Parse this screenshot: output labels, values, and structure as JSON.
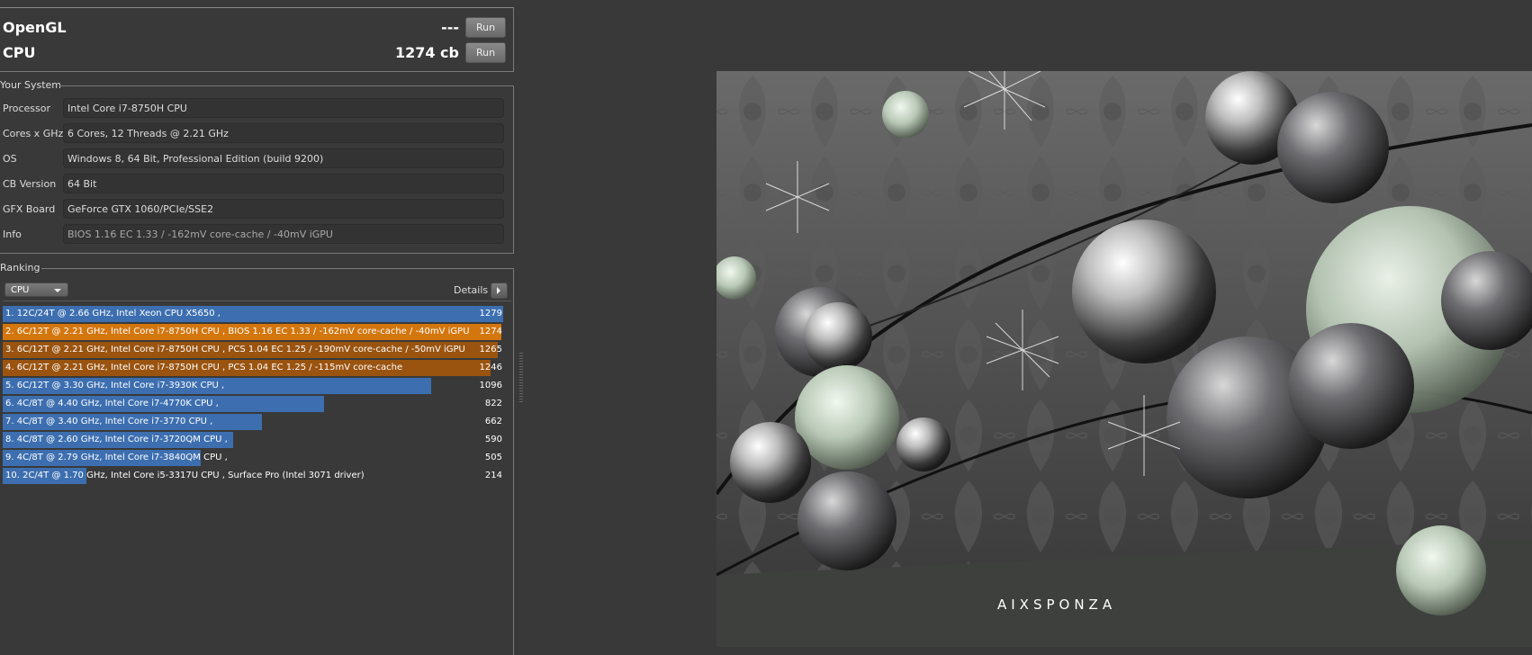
{
  "benchmarks": [
    {
      "label": "OpenGL",
      "score": "---",
      "button": "Run"
    },
    {
      "label": "CPU",
      "score": "1274 cb",
      "button": "Run"
    }
  ],
  "your_system": {
    "title": "Your System",
    "rows": [
      {
        "key": "Processor",
        "value": "Intel Core i7-8750H CPU"
      },
      {
        "key": "Cores x GHz",
        "value": "6 Cores, 12 Threads @ 2.21 GHz"
      },
      {
        "key": "OS",
        "value": "Windows 8, 64 Bit, Professional Edition (build 9200)"
      },
      {
        "key": "CB Version",
        "value": "64 Bit"
      },
      {
        "key": "GFX Board",
        "value": "GeForce GTX 1060/PCIe/SSE2"
      },
      {
        "key": "Info",
        "value": "BIOS 1.16 EC 1.33 / -162mV core-cache / -40mV iGPU"
      }
    ]
  },
  "ranking": {
    "title": "Ranking",
    "selected": "CPU",
    "details_label": "Details",
    "max_score": 1279,
    "rows": [
      {
        "text": "1. 12C/24T @ 2.66 GHz, Intel Xeon CPU X5650 ,",
        "score": "1279",
        "value": 1279,
        "color": "#3d6fb0"
      },
      {
        "text": "2. 6C/12T @ 2.21 GHz, Intel Core i7-8750H CPU , BIOS 1.16 EC 1.33 / -162mV core-cache / -40mV iGPU",
        "score": "1274",
        "value": 1274,
        "color": "#d3760e"
      },
      {
        "text": "3. 6C/12T @ 2.21 GHz, Intel Core i7-8750H CPU , PCS 1.04 EC 1.25 / -190mV core-cache / -50mV iGPU",
        "score": "1265",
        "value": 1265,
        "color": "#9a5410"
      },
      {
        "text": "4. 6C/12T @ 2.21 GHz, Intel Core i7-8750H CPU , PCS 1.04 EC 1.25 / -115mV core-cache",
        "score": "1246",
        "value": 1246,
        "color": "#9a5410"
      },
      {
        "text": "5. 6C/12T @ 3.30 GHz,  Intel Core i7-3930K CPU ,",
        "score": "1096",
        "value": 1096,
        "color": "#3d6fb0"
      },
      {
        "text": "6. 4C/8T @ 4.40 GHz, Intel Core i7-4770K CPU ,",
        "score": "822",
        "value": 822,
        "color": "#3d6fb0"
      },
      {
        "text": "7. 4C/8T @ 3.40 GHz,  Intel Core i7-3770 CPU ,",
        "score": "662",
        "value": 662,
        "color": "#3d6fb0"
      },
      {
        "text": "8. 4C/8T @ 2.60 GHz, Intel Core i7-3720QM CPU ,",
        "score": "590",
        "value": 590,
        "color": "#3d6fb0"
      },
      {
        "text": "9. 4C/8T @ 2.79 GHz,  Intel Core i7-3840QM CPU ,",
        "score": "505",
        "value": 505,
        "color": "#3d6fb0"
      },
      {
        "text": "10. 2C/4T @ 1.70 GHz,  Intel Core i5-3317U CPU , Surface Pro (Intel 3071 driver)",
        "score": "214",
        "value": 214,
        "color": "#3d6fb0"
      }
    ]
  },
  "render": {
    "watermark": "AIXSPONZA"
  }
}
